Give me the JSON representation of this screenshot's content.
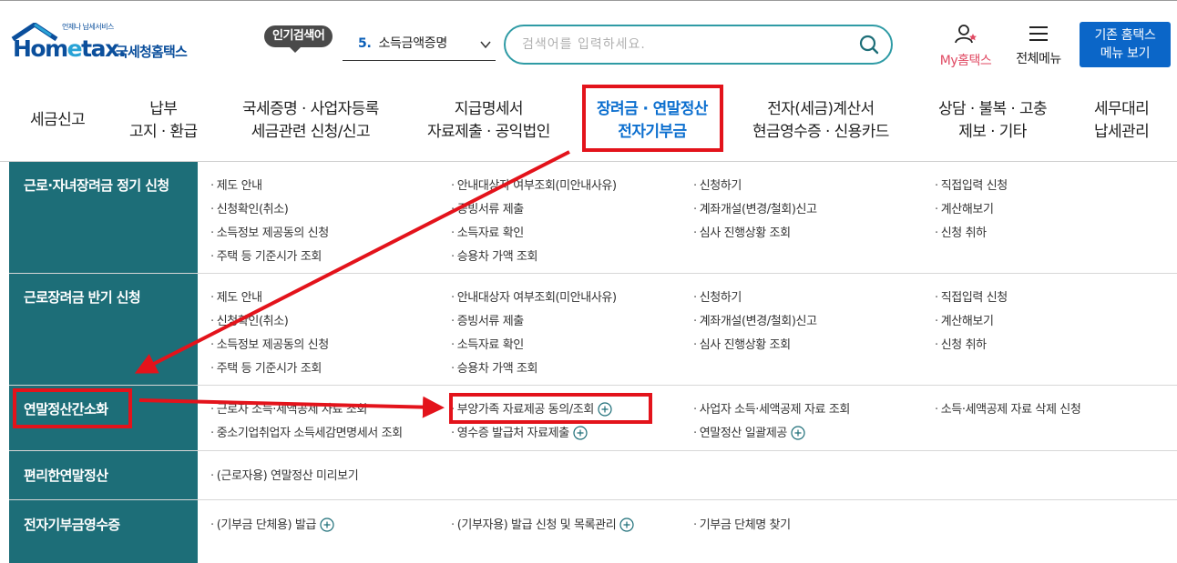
{
  "logo": {
    "brand_main": "Hom",
    "brand_e": "e",
    "brand_tail": "tax.",
    "tagline": "언제나 납세서비스",
    "korean": "국세청홈택스"
  },
  "header": {
    "popular_badge": "인기검색어",
    "popular_rank": "5.",
    "popular_term": "소득금액증명",
    "search_placeholder": "검색어를 입력하세요.",
    "my_home_label": "My홈택스",
    "all_menu_label": "전체메뉴",
    "classic_line1": "기존 홈택스",
    "classic_line2": "메뉴 보기"
  },
  "nav": {
    "items": [
      {
        "l1": "세금신고",
        "l2": ""
      },
      {
        "l1": "납부",
        "l2": "고지 · 환급"
      },
      {
        "l1": "국세증명 · 사업자등록",
        "l2": "세금관련 신청/신고"
      },
      {
        "l1": "지급명세서",
        "l2": "자료제출 · 공익법인"
      },
      {
        "l1": "장려금 · 연말정산",
        "l2": "전자기부금"
      },
      {
        "l1": "전자(세금)계산서",
        "l2": "현금영수증 · 신용카드"
      },
      {
        "l1": "상담 · 불복 · 고충",
        "l2": "제보 · 기타"
      },
      {
        "l1": "세무대리",
        "l2": "납세관리"
      }
    ],
    "active_index": 4
  },
  "menu": {
    "sections": [
      {
        "title": "근로·자녀장려금 정기 신청",
        "columns": [
          [
            "제도 안내",
            "신청확인(취소)",
            "소득정보 제공동의 신청",
            "주택 등 기준시가 조회"
          ],
          [
            "안내대상자 여부조회(미안내사유)",
            "증빙서류 제출",
            "소득자료 확인",
            "승용차 가액 조회"
          ],
          [
            "신청하기",
            "계좌개설(변경/철회)신고",
            "심사 진행상황 조회"
          ],
          [
            "직접입력 신청",
            "계산해보기",
            "신청 취하"
          ]
        ]
      },
      {
        "title": "근로장려금 반기 신청",
        "columns": [
          [
            "제도 안내",
            "신청확인(취소)",
            "소득정보 제공동의 신청",
            "주택 등 기준시가 조회"
          ],
          [
            "안내대상자 여부조회(미안내사유)",
            "증빙서류 제출",
            "소득자료 확인",
            "승용차 가액 조회"
          ],
          [
            "신청하기",
            "계좌개설(변경/철회)신고",
            "심사 진행상황 조회"
          ],
          [
            "직접입력 신청",
            "계산해보기",
            "신청 취하"
          ]
        ]
      },
      {
        "title": "연말정산간소화",
        "columns": [
          [
            "근로자 소득·세액공제 자료 조회",
            "중소기업취업자 소득세감면명세서 조회"
          ],
          [
            "부양가족 자료제공 동의/조회",
            "영수증 발급처 자료제출"
          ],
          [
            "사업자 소득·세액공제 자료 조회",
            "연말정산 일괄제공"
          ],
          [
            "소득·세액공제 자료 삭제 신청"
          ]
        ]
      },
      {
        "title": "편리한연말정산",
        "columns": [
          [
            "(근로자용) 연말정산 미리보기"
          ]
        ]
      },
      {
        "title": "전자기부금영수증",
        "columns": [
          [
            "(기부금 단체용) 발급"
          ],
          [
            "(기부자용) 발급 신청 및 목록관리"
          ],
          [
            "기부금 단체명 찾기"
          ]
        ]
      }
    ]
  },
  "colors": {
    "accent_teal": "#1d6e78",
    "nav_active": "#0c6fcf",
    "highlight_red": "#e3131b",
    "brand_blue": "#0b4f9c",
    "classic_btn": "#0b66c8"
  }
}
